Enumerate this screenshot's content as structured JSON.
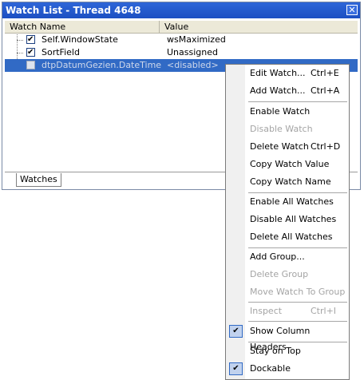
{
  "window": {
    "title": "Watch List - Thread 4648",
    "close_glyph": "✕",
    "columns": {
      "name": "Watch Name",
      "value": "Value"
    },
    "rows": [
      {
        "name": "Self.WindowState",
        "value": "wsMaximized",
        "checked": true
      },
      {
        "name": "SortField",
        "value": "Unassigned",
        "checked": true
      },
      {
        "name": "dtpDatumGezien.DateTime",
        "value": "<disabled>",
        "checked": false
      }
    ],
    "tab": "Watches"
  },
  "menu": {
    "items": [
      {
        "label": "Edit Watch...",
        "shortcut": "Ctrl+E",
        "enabled": true
      },
      {
        "label": "Add Watch...",
        "shortcut": "Ctrl+A",
        "enabled": true
      },
      {
        "label": "Enable Watch",
        "shortcut": "",
        "enabled": true
      },
      {
        "label": "Disable Watch",
        "shortcut": "",
        "enabled": false
      },
      {
        "label": "Delete Watch",
        "shortcut": "Ctrl+D",
        "enabled": true
      },
      {
        "label": "Copy Watch Value",
        "shortcut": "",
        "enabled": true
      },
      {
        "label": "Copy Watch Name",
        "shortcut": "",
        "enabled": true
      },
      {
        "label": "Enable All Watches",
        "shortcut": "",
        "enabled": true
      },
      {
        "label": "Disable All Watches",
        "shortcut": "",
        "enabled": true
      },
      {
        "label": "Delete All Watches",
        "shortcut": "",
        "enabled": true
      },
      {
        "label": "Add Group...",
        "shortcut": "",
        "enabled": true
      },
      {
        "label": "Delete Group",
        "shortcut": "",
        "enabled": false
      },
      {
        "label": "Move Watch To Group",
        "shortcut": "",
        "enabled": false
      },
      {
        "label": "Inspect",
        "shortcut": "Ctrl+I",
        "enabled": false
      },
      {
        "label": "Show Column Headers",
        "shortcut": "",
        "enabled": true,
        "checked": true
      },
      {
        "label": "Stay on Top",
        "shortcut": "",
        "enabled": true
      },
      {
        "label": "Dockable",
        "shortcut": "",
        "enabled": true,
        "checked": true
      }
    ],
    "check_glyph": "✔"
  }
}
